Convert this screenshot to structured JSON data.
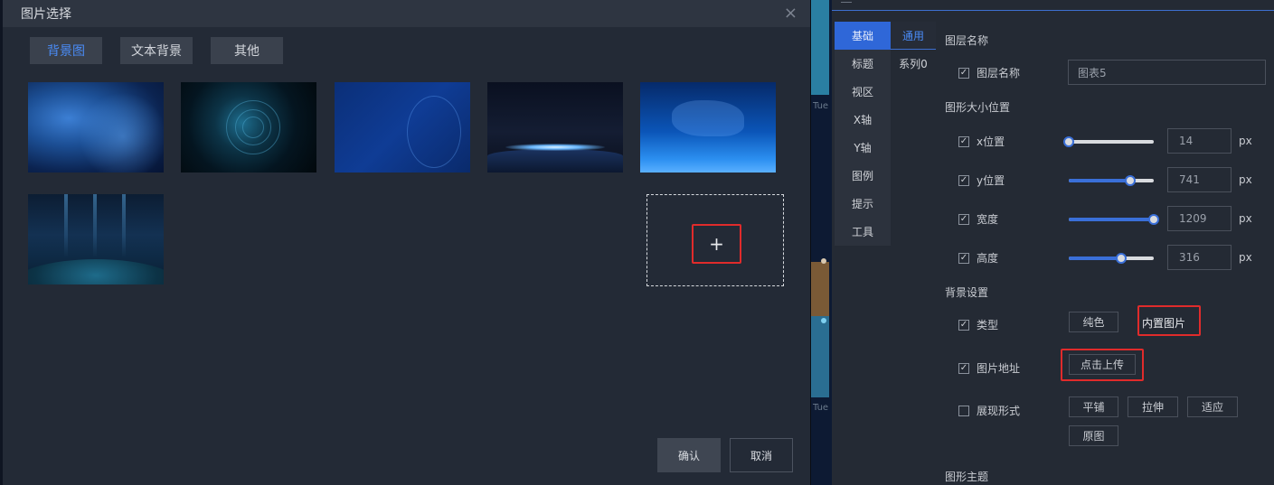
{
  "modal": {
    "title": "图片选择",
    "close_icon": "×",
    "tabs": [
      {
        "label": "背景图",
        "active": true
      },
      {
        "label": "文本背景",
        "active": false
      },
      {
        "label": "其他",
        "active": false
      }
    ],
    "upload_plus": "+",
    "confirm_label": "确认",
    "cancel_label": "取消"
  },
  "background": {
    "tick1": "Tue",
    "tick2": "Tue"
  },
  "panel": {
    "nav_tabs": [
      "基础",
      "标题",
      "视区",
      "X轴",
      "Y轴",
      "图例",
      "提示",
      "工具"
    ],
    "sub_tabs": [
      "通用",
      "系列0"
    ],
    "layer_section": "图层名称",
    "layer_label": "图层名称",
    "layer_value": "图表5",
    "size_section": "图形大小位置",
    "fields": [
      {
        "label": "x位置",
        "value": "14",
        "unit": "px",
        "fraction": 0.0
      },
      {
        "label": "y位置",
        "value": "741",
        "unit": "px",
        "fraction": 0.72
      },
      {
        "label": "宽度",
        "value": "1209",
        "unit": "px",
        "fraction": 1.0
      },
      {
        "label": "高度",
        "value": "316",
        "unit": "px",
        "fraction": 0.62
      }
    ],
    "bg_section": "背景设置",
    "type_label": "类型",
    "type_options": [
      "纯色",
      "内置图片"
    ],
    "image_url_label": "图片地址",
    "upload_label": "点击上传",
    "display_label": "展现形式",
    "display_options": [
      "平铺",
      "拉伸",
      "适应",
      "原图"
    ],
    "theme_section": "图形主题"
  }
}
